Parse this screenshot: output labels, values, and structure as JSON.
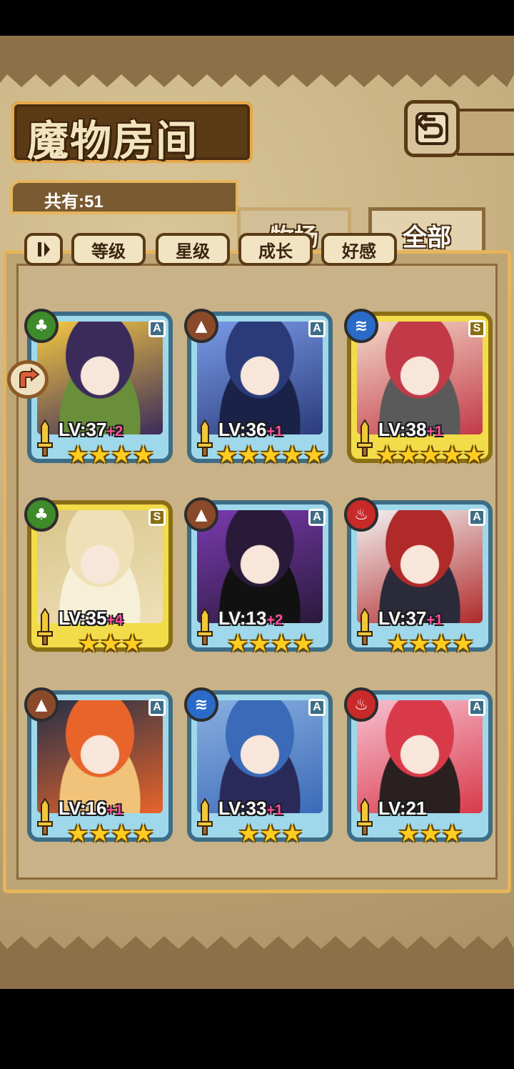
{
  "title": "魔物房间",
  "count_label": "共有:51",
  "tabs": [
    {
      "label": "牧场",
      "active": false
    },
    {
      "label": "全部",
      "active": true
    }
  ],
  "filters": [
    "等级",
    "星级",
    "成长",
    "好感"
  ],
  "sort_icon": "pause-sort-icon",
  "back_icon": "return-arrow-icon",
  "monsters": [
    {
      "level": "LV:37",
      "bonus": "+2",
      "stars": 4,
      "rank": "A",
      "element": "leaf",
      "frame": "blue",
      "colors": [
        "#3b2b5a",
        "#f5c842",
        "#6a8f3a"
      ]
    },
    {
      "level": "LV:36",
      "bonus": "+1",
      "stars": 5,
      "rank": "A",
      "element": "mountain",
      "frame": "blue",
      "colors": [
        "#2b3b7a",
        "#7a9be8",
        "#1a2248"
      ]
    },
    {
      "level": "LV:38",
      "bonus": "+1",
      "stars": 5,
      "rank": "S",
      "element": "water",
      "frame": "gold",
      "colors": [
        "#c23a48",
        "#f2d8c8",
        "#5a5a5a"
      ]
    },
    {
      "level": "LV:35",
      "bonus": "+4",
      "stars": 3,
      "rank": "S",
      "element": "leaf",
      "frame": "gold",
      "colors": [
        "#efe0b8",
        "#d8c48a",
        "#f7f0d8"
      ]
    },
    {
      "level": "LV:13",
      "bonus": "+2",
      "stars": 4,
      "rank": "A",
      "element": "mountain",
      "frame": "blue",
      "colors": [
        "#2a1a3a",
        "#7a3ab0",
        "#111111"
      ]
    },
    {
      "level": "LV:37",
      "bonus": "+1",
      "stars": 4,
      "rank": "A",
      "element": "fire",
      "frame": "blue",
      "colors": [
        "#b02a2a",
        "#f2f2f2",
        "#2a2a3a"
      ]
    },
    {
      "level": "LV:16",
      "bonus": "+1",
      "stars": 4,
      "rank": "A",
      "element": "mountain",
      "frame": "blue",
      "colors": [
        "#e8642a",
        "#243048",
        "#f0c27a"
      ]
    },
    {
      "level": "LV:33",
      "bonus": "+1",
      "stars": 3,
      "rank": "A",
      "element": "water",
      "frame": "blue",
      "colors": [
        "#3a6ab8",
        "#8ab0e0",
        "#2a2a5a"
      ]
    },
    {
      "level": "LV:21",
      "bonus": "",
      "stars": 3,
      "rank": "A",
      "element": "fire",
      "frame": "blue",
      "colors": [
        "#d83a4a",
        "#f7c0d0",
        "#2a2020"
      ]
    }
  ],
  "element_colors": {
    "leaf": "#3f8a2a",
    "mountain": "#8a4a2a",
    "water": "#2a6ac8",
    "fire": "#c82a2a"
  },
  "element_glyphs": {
    "leaf": "♣",
    "mountain": "▲",
    "water": "≋",
    "fire": "♨"
  }
}
